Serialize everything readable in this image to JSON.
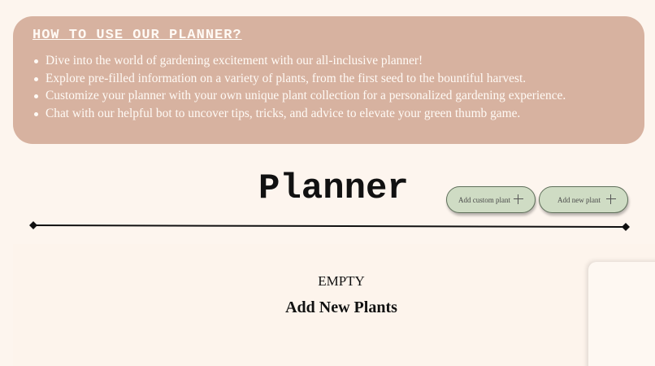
{
  "howto": {
    "title": "HOW TO USE OUR PLANNER?",
    "items": [
      "Dive into the world of gardening excitement with our all-inclusive planner!",
      "Explore pre-filled information on a variety of plants, from the first seed to the bountiful harvest.",
      "Customize your planner with your own unique plant collection for a personalized gardening experience.",
      "Chat with our helpful bot to uncover tips, tricks, and advice to elevate your green thumb game."
    ]
  },
  "planner": {
    "title": "Planner",
    "add_custom_label": "Add custom plant",
    "add_new_label": "Add new plant"
  },
  "plants": {
    "empty_label": "EMPTY",
    "add_heading": "Add New Plants"
  },
  "colors": {
    "background": "#fdf5ee",
    "howto_card": "#d7b2a0",
    "button_fill": "#cfdcc4"
  },
  "icons": [
    "plus-icon",
    "diamond-icon"
  ]
}
